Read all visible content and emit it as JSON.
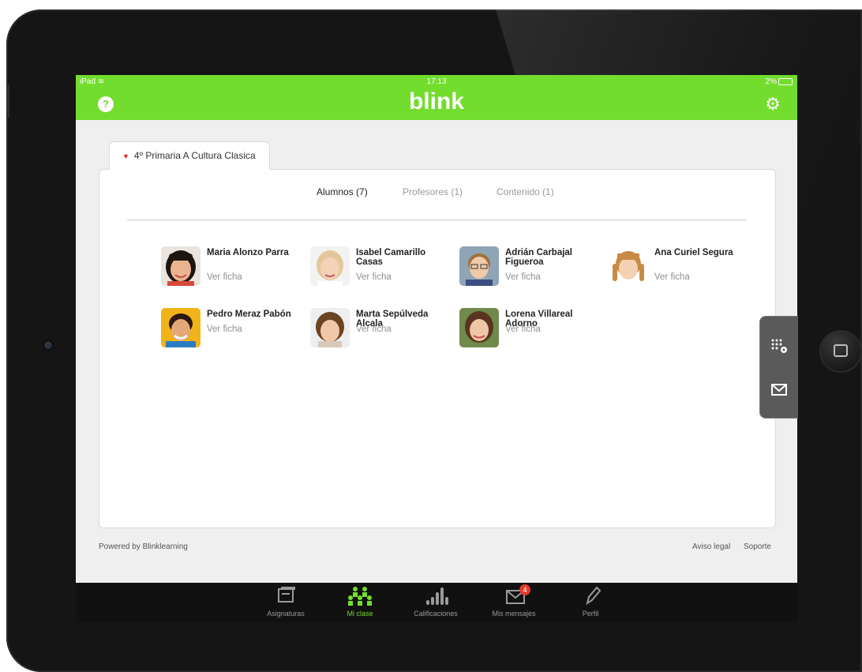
{
  "status_bar": {
    "device": "iPad",
    "time": "17:13",
    "battery": "2%"
  },
  "header": {
    "logo": "blink",
    "help_icon": "help-icon",
    "settings_icon": "gear-icon"
  },
  "course_tab": {
    "label": "4º Primaria A Cultura Clasica"
  },
  "subtabs": [
    {
      "label": "Alumnos (7)",
      "active": true
    },
    {
      "label": "Profesores (1)",
      "active": false
    },
    {
      "label": "Contenido (1)",
      "active": false
    }
  ],
  "students": [
    {
      "name": "Maria Alonzo Parra",
      "link": "Ver ficha"
    },
    {
      "name": "Isabel Camarillo Casas",
      "link": "Ver ficha"
    },
    {
      "name": "Adrián Carbajal Figueroa",
      "link": "Ver ficha"
    },
    {
      "name": "Ana Curiel Segura",
      "link": "Ver ficha"
    },
    {
      "name": "Pedro Meraz Pabón",
      "link": "Ver ficha"
    },
    {
      "name": "Marta Sepúlveda Alcala",
      "link": "Ver ficha"
    },
    {
      "name": "Lorena Villareal Adorno",
      "link": "Ver ficha"
    }
  ],
  "footer": {
    "powered_by": "Powered by Blinklearning",
    "legal": "Aviso legal",
    "support": "Soporte"
  },
  "side_tools": [
    "grid-settings-icon",
    "mail-icon"
  ],
  "tabbar": {
    "items": [
      {
        "label": "Asignaturas",
        "icon": "folder-icon"
      },
      {
        "label": "Mi clase",
        "icon": "group-icon",
        "active": true
      },
      {
        "label": "Calificaciones",
        "icon": "bar-chart-icon"
      },
      {
        "label": "Mis mensajes",
        "icon": "envelope-icon",
        "badge": "4"
      },
      {
        "label": "Perfil",
        "icon": "pencil-icon"
      }
    ]
  },
  "colors": {
    "brand_green": "#72dd2c",
    "badge_red": "#e23b2e"
  }
}
